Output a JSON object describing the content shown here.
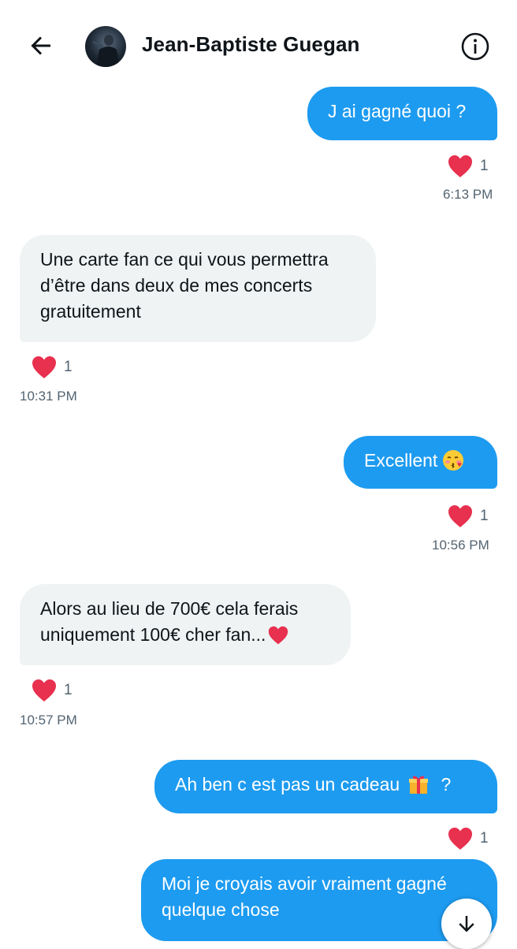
{
  "header": {
    "contact_name": "Jean-Baptiste Guegan"
  },
  "icons": {
    "back": "arrow-left-icon",
    "info": "info-icon",
    "like": "heart-icon",
    "scroll": "arrow-down-icon"
  },
  "colors": {
    "accent": "#1d9bf0",
    "incoming_bg": "#eff3f4",
    "heart": "#f91880",
    "meta_text": "#536471"
  },
  "messages": [
    {
      "direction": "out",
      "text": "J ai gagné quoi ?",
      "likes": "1",
      "time": "6:13 PM"
    },
    {
      "direction": "in",
      "text": "Une carte fan ce qui vous permettra d’être dans deux de mes concerts gratuitement",
      "likes": "1",
      "time": "10:31 PM"
    },
    {
      "direction": "out",
      "text": "Excellent",
      "emoji": "kissing-face-emoji",
      "likes": "1",
      "time": "10:56 PM"
    },
    {
      "direction": "in",
      "text": "Alors au lieu de 700€ cela ferais uniquement 100€ cher fan...",
      "emoji": "red-heart-emoji",
      "likes": "1",
      "time": "10:57 PM"
    },
    {
      "direction": "out",
      "text": "Ah ben c est pas un cadeau",
      "emoji": "gift-emoji",
      "text_after": " ?",
      "likes": "1"
    },
    {
      "direction": "out",
      "text": "Moi je croyais avoir vraiment gagné quelque chose"
    }
  ]
}
